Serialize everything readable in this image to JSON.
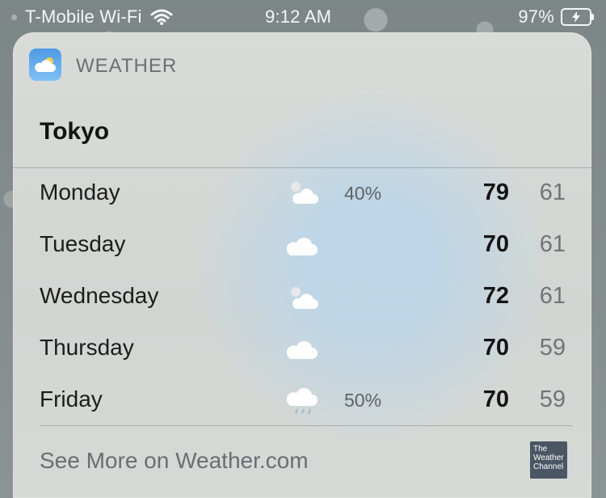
{
  "status_bar": {
    "carrier": "T-Mobile Wi-Fi",
    "time": "9:12 AM",
    "battery": "97%"
  },
  "widget": {
    "app_name": "WEATHER",
    "city": "Tokyo",
    "forecast": [
      {
        "day": "Monday",
        "icon": "partly-cloudy-icon",
        "precip": "40%",
        "high": "79",
        "low": "61"
      },
      {
        "day": "Tuesday",
        "icon": "cloudy-icon",
        "precip": "",
        "high": "70",
        "low": "61"
      },
      {
        "day": "Wednesday",
        "icon": "partly-cloudy-icon",
        "precip": "",
        "high": "72",
        "low": "61"
      },
      {
        "day": "Thursday",
        "icon": "cloudy-icon",
        "precip": "",
        "high": "70",
        "low": "59"
      },
      {
        "day": "Friday",
        "icon": "rain-cloud-icon",
        "precip": "50%",
        "high": "70",
        "low": "59"
      }
    ],
    "footer_link": "See More on Weather.com",
    "provider_logo": [
      "The",
      "Weather",
      "Channel"
    ]
  }
}
